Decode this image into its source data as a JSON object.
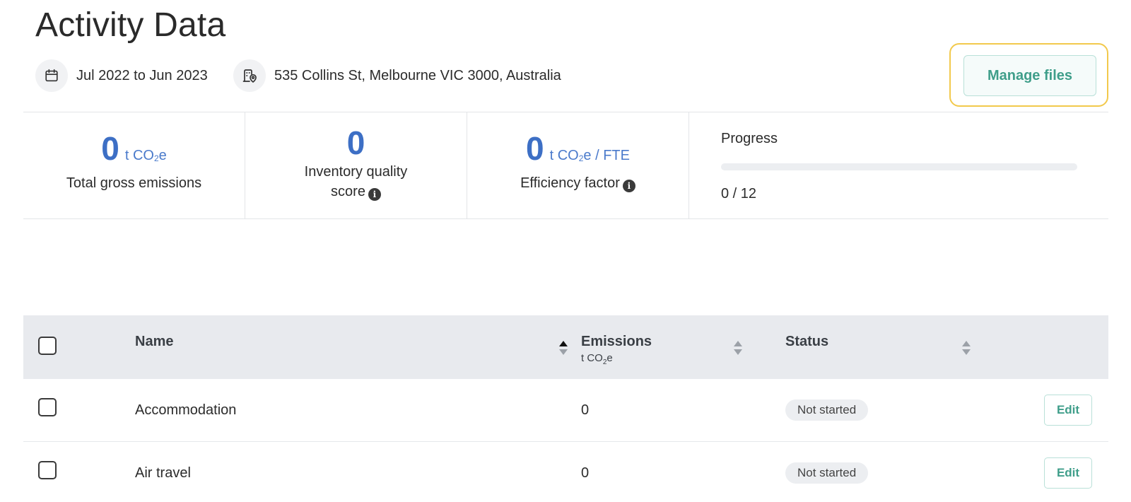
{
  "page": {
    "title": "Activity Data"
  },
  "meta": {
    "date_range": "Jul 2022 to Jun 2023",
    "address": "535 Collins St, Melbourne VIC 3000, Australia",
    "date_icon": "calendar-icon",
    "address_icon": "building-location-icon"
  },
  "actions": {
    "manage_files_label": "Manage files"
  },
  "stats": {
    "total_gross": {
      "value": "0",
      "unit_prefix": "t CO",
      "unit_sub": "2",
      "unit_suffix": "e",
      "label": "Total gross emissions"
    },
    "inventory_quality": {
      "value": "0",
      "label_line1": "Inventory quality",
      "label_line2": "score"
    },
    "efficiency": {
      "value": "0",
      "unit_prefix": "t CO",
      "unit_sub": "2",
      "unit_suffix": "e / FTE",
      "label": "Efficiency factor"
    },
    "progress": {
      "title": "Progress",
      "completed": 0,
      "total": 12,
      "count_text": "0 / 12"
    }
  },
  "table": {
    "columns": {
      "name": "Name",
      "emissions": "Emissions",
      "emissions_unit_prefix": "t CO",
      "emissions_unit_sub": "2",
      "emissions_unit_suffix": "e",
      "status": "Status"
    },
    "rows": [
      {
        "name": "Accommodation",
        "emissions": "0",
        "status": "Not started",
        "action": "Edit"
      },
      {
        "name": "Air travel",
        "emissions": "0",
        "status": "Not started",
        "action": "Edit"
      }
    ]
  },
  "colors": {
    "accent_blue": "#3d6fc5",
    "accent_teal": "#3f9e8a",
    "highlight": "#f2c94c"
  }
}
